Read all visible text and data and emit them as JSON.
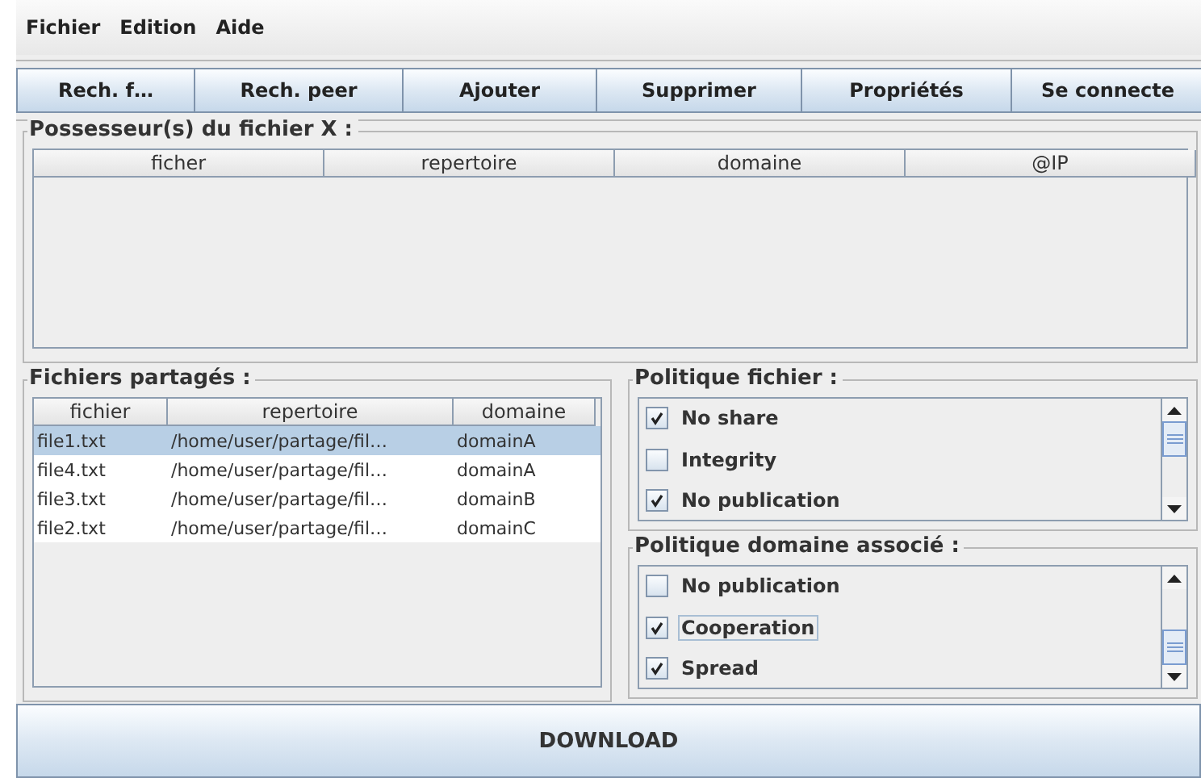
{
  "menu": [
    "Fichier",
    "Edition",
    "Aide"
  ],
  "toolbar": [
    "Rech. f…",
    "Rech. peer",
    "Ajouter",
    "Supprimer",
    "Propriétés",
    "Se connecte"
  ],
  "owners": {
    "title": "Possesseur(s) du fichier X :",
    "columns": [
      "ficher",
      "repertoire",
      "domaine",
      "@IP"
    ]
  },
  "shared": {
    "title": "Fichiers partagés :",
    "columns": [
      "fichier",
      "repertoire",
      "domaine"
    ],
    "rows": [
      {
        "cells": [
          "file1.txt",
          "/home/user/partage/fil…",
          "domainA"
        ],
        "selected": true
      },
      {
        "cells": [
          "file4.txt",
          "/home/user/partage/fil…",
          "domainA"
        ],
        "selected": false
      },
      {
        "cells": [
          "file3.txt",
          "/home/user/partage/fil…",
          "domainB"
        ],
        "selected": false
      },
      {
        "cells": [
          "file2.txt",
          "/home/user/partage/fil…",
          "domainC"
        ],
        "selected": false
      }
    ]
  },
  "file_policy": {
    "title": "Politique fichier :",
    "items": [
      {
        "label": "No share",
        "checked": true,
        "focused": false
      },
      {
        "label": "Integrity",
        "checked": false,
        "focused": false
      },
      {
        "label": "No publication",
        "checked": true,
        "focused": false
      }
    ]
  },
  "domain_policy": {
    "title": "Politique domaine associé :",
    "items": [
      {
        "label": "No publication",
        "checked": false,
        "focused": false
      },
      {
        "label": "Cooperation",
        "checked": true,
        "focused": true
      },
      {
        "label": "Spread",
        "checked": true,
        "focused": false
      }
    ]
  },
  "download": "DOWNLOAD"
}
